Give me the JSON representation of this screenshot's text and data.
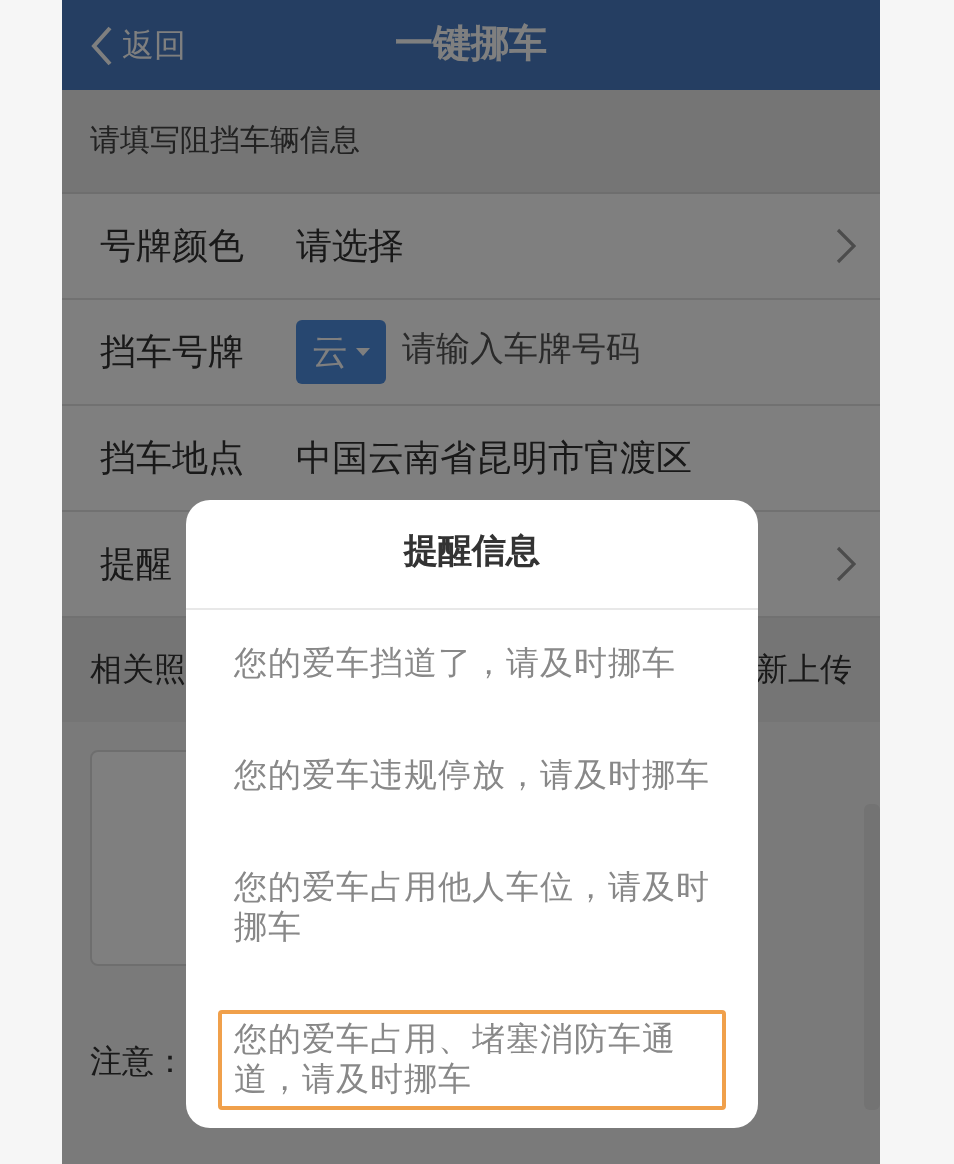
{
  "header": {
    "back_label": "返回",
    "title": "一键挪车"
  },
  "section_title": "请填写阻挡车辆信息",
  "form_rows": [
    {
      "kind": "select",
      "label": "号牌颜色",
      "value": "请选择"
    },
    {
      "kind": "plate",
      "label": "挡车号牌",
      "prefix": "云",
      "placeholder": "请输入车牌号码"
    },
    {
      "kind": "text",
      "label": "挡车地点",
      "value": "中国云南省昆明市官渡区"
    },
    {
      "kind": "select",
      "label": "提醒"
    }
  ],
  "photos": {
    "label": "相关照",
    "action": "新上传"
  },
  "note_label": "注意：",
  "dialog": {
    "title": "提醒信息",
    "options": [
      {
        "text": "您的爱车挡道了，请及时挪车",
        "selected": false
      },
      {
        "text": "您的爱车违规停放，请及时挪车",
        "selected": false
      },
      {
        "text": "您的爱车占用他人车位，请及时挪车",
        "selected": false
      },
      {
        "text": "您的爱车占用、堵塞消防车通道，请及时挪车",
        "selected": true
      }
    ]
  }
}
